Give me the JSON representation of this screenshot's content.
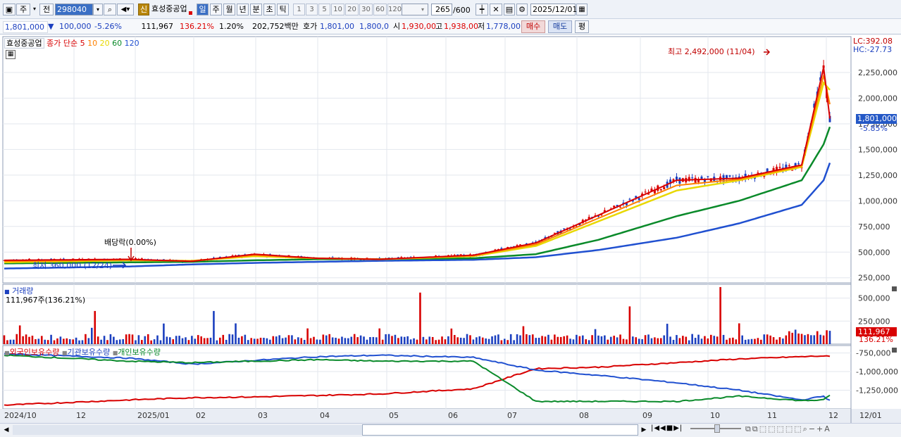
{
  "toolbar": {
    "period_label": "주",
    "all_label": "전",
    "code": "298040",
    "new_badge": "신",
    "stock_name": "효성중공업",
    "timeframes": [
      "일",
      "주",
      "월",
      "년",
      "분",
      "초",
      "틱"
    ],
    "active_timeframe": "일",
    "intervals": [
      "1",
      "3",
      "5",
      "10",
      "20",
      "30",
      "60",
      "120"
    ],
    "count": "265",
    "count_total": "/600",
    "date": "2025/12/01",
    "icons": [
      "window-icon",
      "search-icon",
      "speaker-icon",
      "candle-icon",
      "crosshair-icon",
      "save-icon",
      "gear-icon",
      "calendar-icon"
    ]
  },
  "quote": {
    "price": "1,801,000",
    "arrow": "▼",
    "change": "100,000",
    "change_pct": "-5.26%",
    "volume": "111,967",
    "volume_ratio": "136.21%",
    "turnover": "1.20%",
    "amount": "202,752백만",
    "ask_label": "호가",
    "ask": "1,801,00",
    "bid": "1,800,0",
    "open_label": "시",
    "open": "1,930,00",
    "high_label": "고",
    "high": "1,938,00",
    "low_label": "저",
    "low": "1,778,00",
    "buy_label": "매수",
    "sell_label": "매도",
    "eval_label": "평"
  },
  "chart_legend": {
    "name": "효성중공업",
    "price_label": "종가 단순",
    "ma": [
      "5",
      "10",
      "20",
      "60",
      "120"
    ],
    "ma_colors": [
      "#d80000",
      "#ff8000",
      "#e8d800",
      "#0a8a2a",
      "#2050d0"
    ]
  },
  "annotations": {
    "high_text": "최고 2,492,000 (11/04)",
    "low_text": "최저 360,000 (12/24)",
    "dividend_text": "배당락(0.00%)",
    "lc": "LC:392.08",
    "hc": "HC:-27.73",
    "last_price_tag": "1,801,000",
    "last_pct_tag": "-5.85%"
  },
  "volume_panel": {
    "title": "거래량",
    "summary": "111,967주(136.21%)",
    "last_tag": "111,967",
    "last_pct": "136.21%"
  },
  "holdings_panel": {
    "legends": [
      "외국인보유수량",
      "기관보유수량",
      "개인보유수량"
    ]
  },
  "x_axis": [
    "2024/10",
    "12",
    "2025/01",
    "02",
    "03",
    "04",
    "05",
    "06",
    "07",
    "08",
    "09",
    "10",
    "11",
    "12",
    "12/01"
  ],
  "chart_data": [
    {
      "type": "line",
      "title": "효성중공업",
      "x": [
        "2024/10",
        "2024/12",
        "2025/01",
        "2025/02",
        "2025/03",
        "2025/04",
        "2025/05",
        "2025/06",
        "2025/07",
        "2025/08",
        "2025/09",
        "2025/10",
        "2025/11",
        "2025/12"
      ],
      "series": [
        {
          "name": "5",
          "values": [
            420000,
            430000,
            410000,
            480000,
            440000,
            430000,
            470000,
            590000,
            860000,
            1200000,
            1220000,
            1350000,
            2300000,
            1801000
          ]
        },
        {
          "name": "20",
          "values": [
            400000,
            420000,
            415000,
            460000,
            440000,
            430000,
            460000,
            560000,
            800000,
            1100000,
            1200000,
            1330000,
            2150000,
            2080000
          ]
        },
        {
          "name": "60",
          "values": [
            390000,
            400000,
            405000,
            420000,
            430000,
            432000,
            440000,
            480000,
            620000,
            850000,
            1000000,
            1200000,
            1550000,
            1720000
          ]
        },
        {
          "name": "120",
          "values": [
            340000,
            360000,
            380000,
            395000,
            405000,
            415000,
            425000,
            450000,
            520000,
            640000,
            780000,
            960000,
            1200000,
            1370000
          ]
        }
      ],
      "yticks": [
        "250,000",
        "500,000",
        "750,000",
        "1,000,000",
        "1,250,000",
        "1,500,000",
        "1,750,000",
        "2,000,000",
        "2,250,000"
      ],
      "ylim": [
        200000,
        2600000
      ]
    },
    {
      "type": "bar",
      "title": "거래량",
      "yticks": [
        "250,000",
        "500,000"
      ],
      "ylim": [
        0,
        650000
      ]
    },
    {
      "type": "line",
      "series": [
        {
          "name": "외국인보유수량",
          "values": [
            -1450000,
            -1380000,
            -1350000,
            -1340000,
            -1320000,
            -1300000,
            -1230000,
            -960000,
            -940000,
            -880000,
            -830000,
            -800000,
            -790000,
            -800000
          ]
        },
        {
          "name": "기관보유수량",
          "values": [
            -760000,
            -820000,
            -900000,
            -850000,
            -800000,
            -780000,
            -810000,
            -980000,
            -1050000,
            -1150000,
            -1250000,
            -1380000,
            -1330000,
            -1390000
          ]
        },
        {
          "name": "개인보유수량",
          "values": [
            -780000,
            -860000,
            -880000,
            -860000,
            -840000,
            -860000,
            -860000,
            -1400000,
            -1400000,
            -1400000,
            -1330000,
            -1390000,
            -1380000,
            -1320000
          ]
        }
      ],
      "yticks": [
        "-750,000",
        "-1,000,000",
        "-1,250,000"
      ],
      "ylim": [
        -1500000,
        -650000
      ]
    }
  ]
}
